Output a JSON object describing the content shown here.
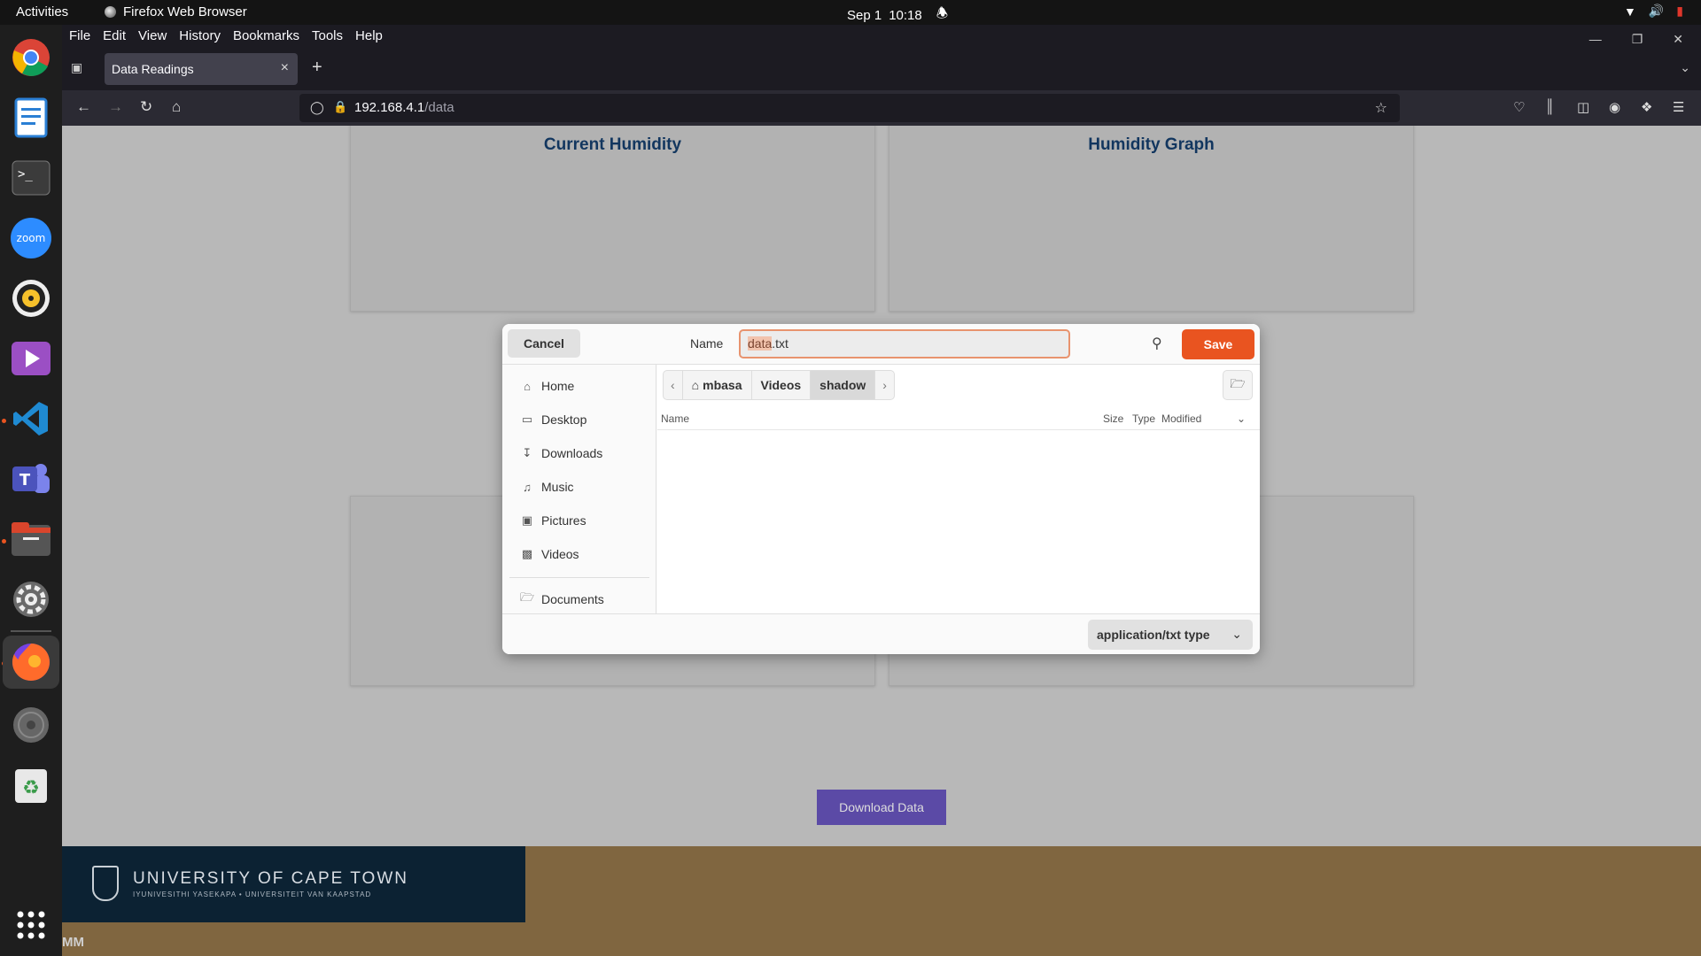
{
  "topbar": {
    "activities": "Activities",
    "app_name": "Firefox Web Browser",
    "date": "Sep 1",
    "time": "10:18"
  },
  "dock": {
    "items": [
      "chrome-icon",
      "writer-icon",
      "terminal-icon",
      "zoom-icon",
      "rhythmbox-icon",
      "video-icon",
      "vscode-icon",
      "teams-icon",
      "files-icon",
      "settings-icon",
      "firefox-icon",
      "disc-icon",
      "trash-icon",
      "app-grid-icon"
    ],
    "zoom_label": "zoom"
  },
  "menubar": [
    "File",
    "Edit",
    "View",
    "History",
    "Bookmarks",
    "Tools",
    "Help"
  ],
  "tab": {
    "title": "Data Readings"
  },
  "urlbar": {
    "host": "192.168.4.1",
    "path": "/data"
  },
  "page": {
    "card1_title": "Current Humidity",
    "card2_title": "Humidity Graph",
    "download_label": "Download Data",
    "logo_name": "UNIVERSITY OF CAPE TOWN",
    "logo_sub": "IYUNIVESITHI YASEKAPA • UNIVERSITEIT VAN KAAPSTAD",
    "initials": "MM"
  },
  "dialog": {
    "cancel_label": "Cancel",
    "name_label": "Name",
    "filename_selected": "data",
    "filename_ext": ".txt",
    "save_label": "Save",
    "places": [
      {
        "label": "Home",
        "icon": "home-icon"
      },
      {
        "label": "Desktop",
        "icon": "desktop-icon"
      },
      {
        "label": "Downloads",
        "icon": "download-icon"
      },
      {
        "label": "Music",
        "icon": "music-icon"
      },
      {
        "label": "Pictures",
        "icon": "pictures-icon"
      },
      {
        "label": "Videos",
        "icon": "videos-icon"
      },
      {
        "label": "Documents",
        "icon": "folder-icon"
      }
    ],
    "path": [
      "mbasa",
      "Videos",
      "shadow"
    ],
    "columns": {
      "name": "Name",
      "size": "Size",
      "type": "Type",
      "modified": "Modified"
    },
    "filetype": "application/txt type"
  },
  "colors": {
    "accent": "#e95420",
    "download_button": "#5b4aa6",
    "footer": "#806640",
    "card_title": "#12365f"
  }
}
